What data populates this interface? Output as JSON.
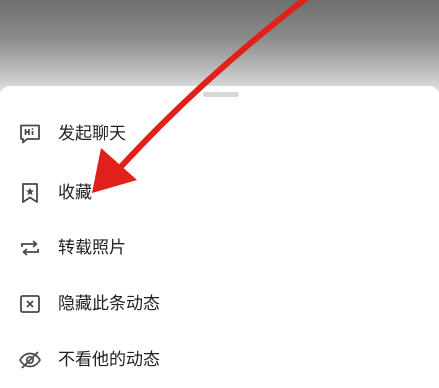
{
  "sheet": {
    "items": [
      {
        "label": "发起聊天",
        "icon": "hi-chat-bubble-icon"
      },
      {
        "label": "收藏",
        "icon": "bookmark-star-icon"
      },
      {
        "label": "转载照片",
        "icon": "repost-icon"
      },
      {
        "label": "隐藏此条动态",
        "icon": "hide-x-box-icon"
      },
      {
        "label": "不看他的动态",
        "icon": "eye-off-icon"
      }
    ]
  },
  "annotation": {
    "arrow_color": "#e0201b",
    "points_to": "收藏"
  },
  "colors": {
    "icon": "#4a4a4a",
    "text": "#222222"
  }
}
